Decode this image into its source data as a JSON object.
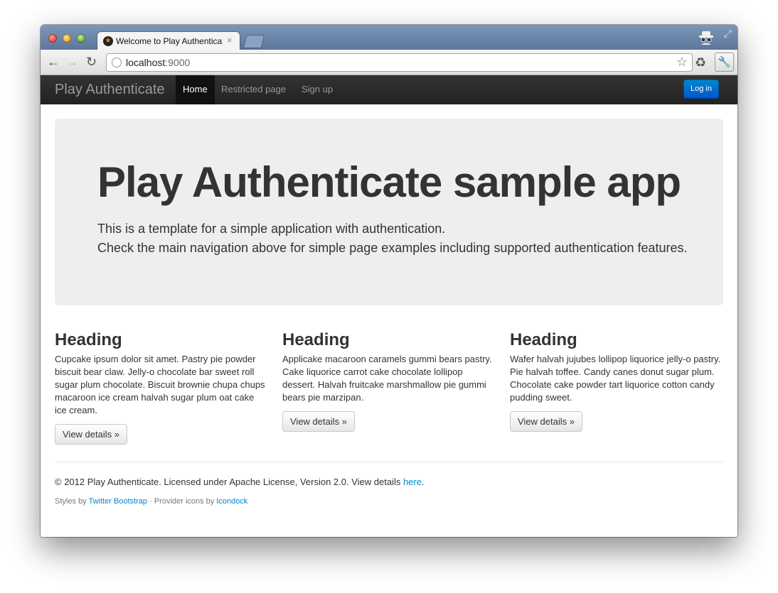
{
  "browser": {
    "tab_title": "Welcome to Play Authenticate",
    "tab_close": "×",
    "url_host": "localhost",
    "url_port": ":9000",
    "icons": [
      "back-arrow-icon",
      "forward-arrow-icon",
      "reload-icon",
      "globe-icon",
      "bookmark-star-icon",
      "extension-icon",
      "wrench-icon",
      "incognito-icon",
      "fullscreen-icon"
    ]
  },
  "navbar": {
    "brand": "Play Authenticate",
    "items": [
      {
        "label": "Home"
      },
      {
        "label": "Restricted page"
      },
      {
        "label": "Sign up"
      }
    ],
    "login_label": "Log in",
    "login_color": "#0074cc"
  },
  "hero": {
    "title": "Play Authenticate sample app",
    "line1": "This is a template for a simple application with authentication.",
    "line2": "Check the main navigation above for simple page examples including supported authentication features."
  },
  "columns": [
    {
      "heading": "Heading",
      "text": "Cupcake ipsum dolor sit amet. Pastry pie powder biscuit bear claw. Jelly-o chocolate bar sweet roll sugar plum chocolate. Biscuit brownie chupa chups macaroon ice cream halvah sugar plum oat cake ice cream.",
      "button": "View details »"
    },
    {
      "heading": "Heading",
      "text": "Applicake macaroon caramels gummi bears pastry. Cake liquorice carrot cake chocolate lollipop dessert. Halvah fruitcake marshmallow pie gummi bears pie marzipan.",
      "button": "View details »"
    },
    {
      "heading": "Heading",
      "text": "Wafer halvah jujubes lollipop liquorice jelly-o pastry. Pie halvah toffee. Candy canes donut sugar plum. Chocolate cake powder tart liquorice cotton candy pudding sweet.",
      "button": "View details »"
    }
  ],
  "footer": {
    "license_text": "© 2012 Play Authenticate. Licensed under Apache License, Version 2.0. View details ",
    "license_link": "here",
    "license_end": ".",
    "styles_prefix": "Styles by ",
    "styles_link": "Twitter Bootstrap",
    "icons_prefix": " · Provider icons by ",
    "icons_link": "Icondock"
  }
}
